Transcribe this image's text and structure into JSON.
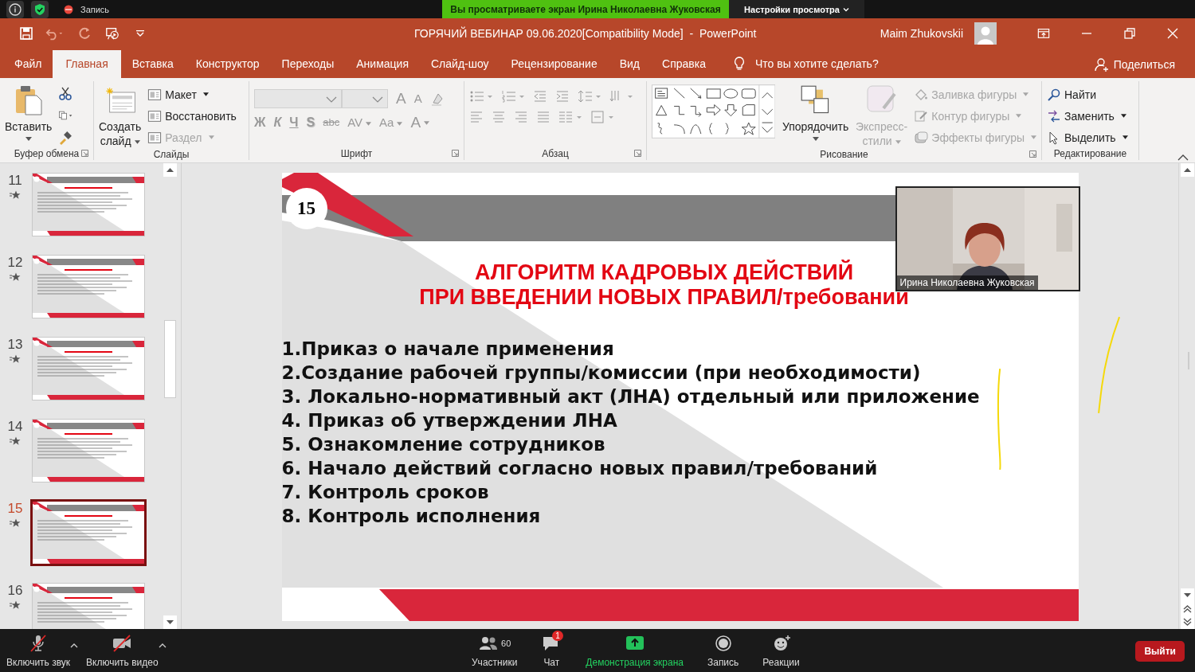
{
  "zoom_top": {
    "recording": "Запись",
    "banner": "Вы просматриваете экран Ирина Николаевна Жуковская",
    "view_options": "Настройки просмотра"
  },
  "title_bar": {
    "title": "ГОРЯЧИЙ ВЕБИНАР 09.06.2020[Compatibility Mode]  -  PowerPoint",
    "user": "Maim Zhukovskii"
  },
  "tabs": [
    {
      "label": "Файл",
      "selected": false
    },
    {
      "label": "Главная",
      "selected": true
    },
    {
      "label": "Вставка",
      "selected": false
    },
    {
      "label": "Конструктор",
      "selected": false
    },
    {
      "label": "Переходы",
      "selected": false
    },
    {
      "label": "Анимация",
      "selected": false
    },
    {
      "label": "Слайд-шоу",
      "selected": false
    },
    {
      "label": "Рецензирование",
      "selected": false
    },
    {
      "label": "Вид",
      "selected": false
    },
    {
      "label": "Справка",
      "selected": false
    }
  ],
  "tell_me": "Что вы хотите сделать?",
  "share": "Поделиться",
  "ribbon": {
    "clipboard": {
      "label": "Буфер обмена",
      "paste": "Вставить"
    },
    "slides": {
      "label": "Слайды",
      "new_slide_lines": [
        "Создать",
        "слайд"
      ],
      "items": [
        {
          "text": "Макет",
          "disabled": false
        },
        {
          "text": "Восстановить",
          "disabled": false
        },
        {
          "text": "Раздел",
          "disabled": true
        }
      ]
    },
    "font": {
      "label": "Шрифт",
      "top_buttons": [
        {
          "text": "A",
          "kind": "grow"
        },
        {
          "text": "A",
          "kind": "shrink"
        }
      ],
      "format_buttons": [
        {
          "text": "Ж",
          "kind": "bold"
        },
        {
          "text": "К",
          "kind": "italic"
        },
        {
          "text": "Ч",
          "kind": "underline"
        },
        {
          "text": "S",
          "kind": "shadow"
        },
        {
          "text": "abc",
          "kind": "strike"
        },
        {
          "text": "AV",
          "kind": "spacing"
        },
        {
          "text": "Aa",
          "kind": "case"
        },
        {
          "text": "A",
          "kind": "color"
        }
      ]
    },
    "paragraph": {
      "label": "Абзац"
    },
    "drawing": {
      "label": "Рисование",
      "arrange": "Упорядочить",
      "quick_styles_lines": [
        "Экспресс-",
        "стили"
      ],
      "items": [
        {
          "text": "Заливка фигуры",
          "kind": "fill",
          "disabled": true
        },
        {
          "text": "Контур фигуры",
          "kind": "outline",
          "disabled": true
        },
        {
          "text": "Эффекты фигуры",
          "kind": "effects",
          "disabled": true
        }
      ]
    },
    "editing": {
      "label": "Редактирование",
      "items": [
        {
          "text": "Найти",
          "kind": "find"
        },
        {
          "text": "Заменить",
          "kind": "replace"
        },
        {
          "text": "Выделить",
          "kind": "select"
        }
      ]
    }
  },
  "thumbnails": [
    {
      "number": "11",
      "selected": false
    },
    {
      "number": "12",
      "selected": false
    },
    {
      "number": "13",
      "selected": false
    },
    {
      "number": "14",
      "selected": false
    },
    {
      "number": "15",
      "selected": true
    },
    {
      "number": "16",
      "selected": false
    }
  ],
  "slide": {
    "number": "15",
    "title_lines": [
      "АЛГОРИТМ КАДРОВЫХ ДЕЙСТВИЙ",
      "ПРИ ВВЕДЕНИИ НОВЫХ ПРАВИЛ/требований"
    ],
    "items": [
      "1.Приказ о начале применения",
      "2.Создание рабочей группы/комиссии (при необходимости)",
      "3. Локально-нормативный акт (ЛНА) отдельный или приложение",
      "4. Приказ об утверждении ЛНА",
      "5. Ознакомление сотрудников",
      "6. Начало действий согласно новых правил/требований",
      "7. Контроль сроков",
      "8. Контроль исполнения"
    ]
  },
  "video": {
    "name": "Ирина Николаевна Жуковская"
  },
  "bottom_bar": {
    "left": [
      {
        "label": "Включить звук",
        "kind": "mic"
      },
      {
        "label": "Включить видео",
        "kind": "video"
      }
    ],
    "center": [
      {
        "label": "Участники",
        "kind": "participants",
        "count": "60"
      },
      {
        "label": "Чат",
        "kind": "chat",
        "badge": "1"
      },
      {
        "label": "Демонстрация экрана",
        "kind": "share",
        "active": true
      },
      {
        "label": "Запись",
        "kind": "record",
        "active": false
      },
      {
        "label": "Реакции",
        "kind": "reactions"
      }
    ],
    "leave": "Выйти"
  }
}
